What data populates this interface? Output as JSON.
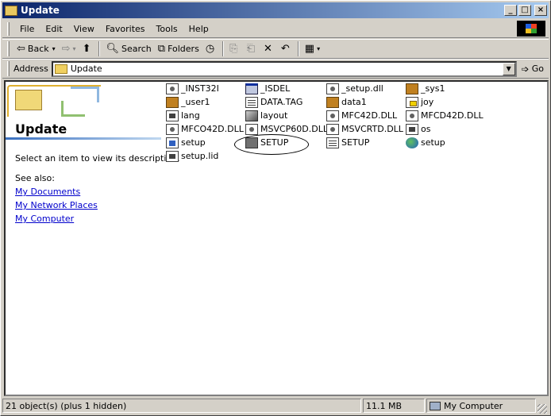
{
  "window": {
    "title": "Update"
  },
  "menu": [
    "File",
    "Edit",
    "View",
    "Favorites",
    "Tools",
    "Help"
  ],
  "toolbar": {
    "back_label": "Back",
    "search_label": "Search",
    "folders_label": "Folders"
  },
  "address": {
    "label": "Address",
    "value": "Update",
    "go_label": "Go"
  },
  "left_pane": {
    "title": "Update",
    "description": "Select an item to view its description.",
    "see_also": "See also:",
    "links": [
      "My Documents",
      "My Network Places",
      "My Computer"
    ]
  },
  "files": [
    {
      "name": "_INST32I",
      "icon": "gear-icon"
    },
    {
      "name": "_ISDEL",
      "icon": "window-icon"
    },
    {
      "name": "_setup.dll",
      "icon": "dll-icon"
    },
    {
      "name": "_sys1",
      "icon": "book-icon"
    },
    {
      "name": "_user1",
      "icon": "book-icon"
    },
    {
      "name": "DATA.TAG",
      "icon": "text-icon"
    },
    {
      "name": "data1",
      "icon": "book-icon"
    },
    {
      "name": "joy",
      "icon": "ini-icon"
    },
    {
      "name": "lang",
      "icon": "doc-icon"
    },
    {
      "name": "layout",
      "icon": "installer-icon"
    },
    {
      "name": "MFC42D.DLL",
      "icon": "dll-icon"
    },
    {
      "name": "MFCD42D.DLL",
      "icon": "dll-icon"
    },
    {
      "name": "MFCO42D.DLL",
      "icon": "dll-icon"
    },
    {
      "name": "MSVCP60D.DLL",
      "icon": "dll-icon"
    },
    {
      "name": "MSVCRTD.DLL",
      "icon": "dll-icon"
    },
    {
      "name": "os",
      "icon": "doc-icon"
    },
    {
      "name": "setup",
      "icon": "setup-config-icon"
    },
    {
      "name": "SETUP",
      "icon": "computer-setup-icon"
    },
    {
      "name": "SETUP",
      "icon": "text-icon"
    },
    {
      "name": "setup",
      "icon": "globe-icon"
    },
    {
      "name": "setup.lid",
      "icon": "doc-icon"
    }
  ],
  "status": {
    "objects": "21 object(s) (plus 1 hidden)",
    "size": "11.1 MB",
    "location": "My Computer"
  }
}
